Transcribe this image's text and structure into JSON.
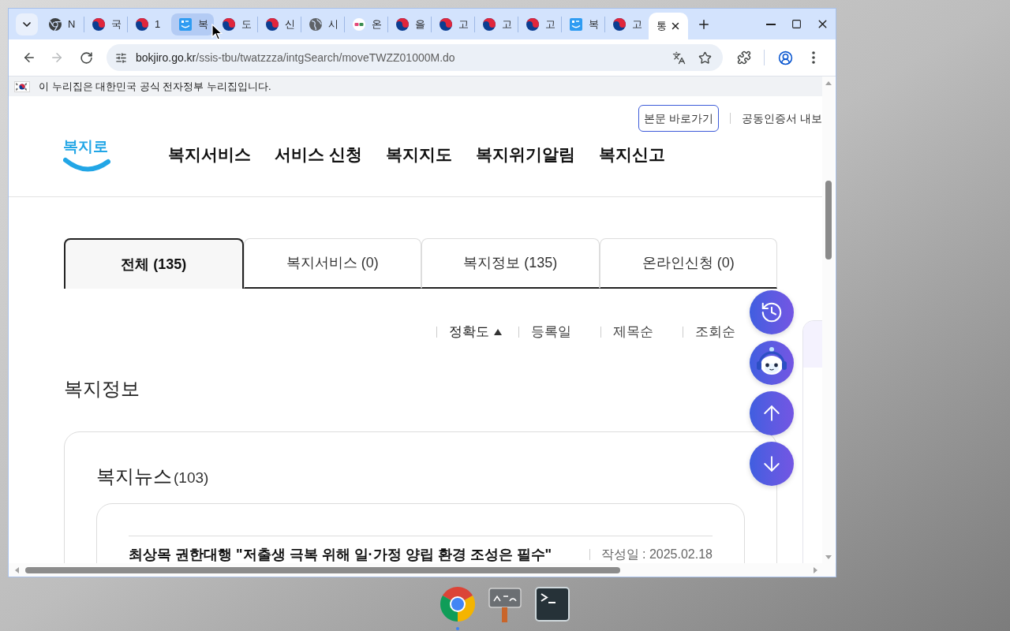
{
  "browser": {
    "tabs": [
      {
        "kind": "chrome",
        "label": "N",
        "selected": false,
        "hovered": false
      },
      {
        "kind": "gov",
        "label": "국",
        "selected": false,
        "hovered": false
      },
      {
        "kind": "gov",
        "label": "1",
        "selected": false,
        "hovered": false
      },
      {
        "kind": "bokjiro",
        "label": "복",
        "selected": false,
        "hovered": true
      },
      {
        "kind": "gov",
        "label": "도",
        "selected": false,
        "hovered": false
      },
      {
        "kind": "gov",
        "label": "신",
        "selected": false,
        "hovered": false
      },
      {
        "kind": "globe",
        "label": "시",
        "selected": false,
        "hovered": false
      },
      {
        "kind": "gonggam",
        "label": "온",
        "selected": false,
        "hovered": false
      },
      {
        "kind": "gov",
        "label": "을",
        "selected": false,
        "hovered": false
      },
      {
        "kind": "gov",
        "label": "고",
        "selected": false,
        "hovered": false
      },
      {
        "kind": "gov",
        "label": "고",
        "selected": false,
        "hovered": false
      },
      {
        "kind": "gov",
        "label": "고",
        "selected": false,
        "hovered": false
      },
      {
        "kind": "bokjiro",
        "label": "복",
        "selected": false,
        "hovered": false
      },
      {
        "kind": "gov",
        "label": "고",
        "selected": false,
        "hovered": false
      },
      {
        "kind": "plain",
        "label": "통",
        "selected": true,
        "hovered": false
      }
    ],
    "forward_disabled": true,
    "url": {
      "host": "bokjiro.go.kr",
      "path": "/ssis-tbu/twatzzza/intgSearch/moveTWZZ01000M.do"
    }
  },
  "gov_banner": {
    "text": "이 누리집은 대한민국 공식 전자정부 누리집입니다."
  },
  "header": {
    "utility_links": [
      {
        "label": "본문 바로가기",
        "kind": "outlined"
      },
      {
        "label": "공동인증서 내보",
        "kind": "plain"
      }
    ],
    "logo": "복지로",
    "nav": [
      "복지서비스",
      "서비스 신청",
      "복지지도",
      "복지위기알림",
      "복지신고"
    ]
  },
  "result_tabs": [
    {
      "label": "전체 (135)",
      "selected": true
    },
    {
      "label": "복지서비스 (0)",
      "selected": false
    },
    {
      "label": "복지정보 (135)",
      "selected": false
    },
    {
      "label": "온라인신청 (0)",
      "selected": false
    }
  ],
  "sort_options": [
    {
      "label": "정확도",
      "selected": true
    },
    {
      "label": "등록일",
      "selected": false
    },
    {
      "label": "제목순",
      "selected": false
    },
    {
      "label": "조회순",
      "selected": false
    }
  ],
  "section_title": "복지정보",
  "news": {
    "title": "복지뉴스",
    "count": "(103)",
    "items": [
      {
        "title": "최상목 권한대행 \"저출생 극복 위해 일·가정 양립 환경 조성은 필수\"",
        "date": "작성일 : 2025.02.18"
      }
    ]
  },
  "floating_buttons": [
    {
      "kind": "history"
    },
    {
      "kind": "chatbot"
    },
    {
      "kind": "up"
    },
    {
      "kind": "down"
    }
  ],
  "taskbar": {
    "apps": [
      {
        "kind": "chrome",
        "running": true
      },
      {
        "kind": "signboard",
        "running": false
      },
      {
        "kind": "terminal",
        "running": false
      }
    ]
  }
}
